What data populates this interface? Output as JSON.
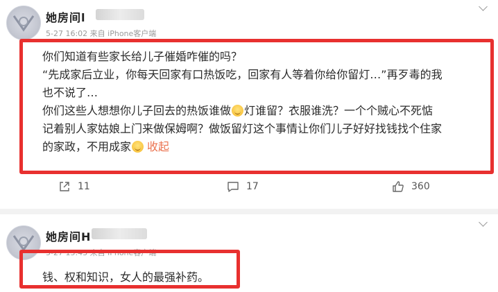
{
  "posts": [
    {
      "username": "她房间l",
      "meta": "5-27 16:02 来自 iPhone客户端",
      "lines": [
        "你们知道有些家长给儿子催婚咋催的吗？",
        "“先成家后立业，你每天回家有口热饭吃，回家有人等着你给你留灯…”再歹毒的我",
        "也不说了…",
        "你们这些人想想你儿子回去的热饭谁做",
        "灯谁留？衣服谁洗？一个个贼心不死惦",
        "记着别人家姑娘上门来做保姆啊？做饭留灯这个事情让你们儿子好好找钱找个住家",
        "的家政，不用成家"
      ],
      "collapse_label": "收起",
      "actions": {
        "repost": "11",
        "comment": "17",
        "like": "360"
      }
    },
    {
      "username": "她房间H",
      "meta": "5-27 15:43 来自 iPhone客户端",
      "lines": [
        "钱、权和知识，女人的最强补药。"
      ]
    }
  ],
  "colors": {
    "highlight_box": "#e8302f",
    "collapse_link": "#eb7350",
    "divider": "#f2f2f2"
  },
  "icons": [
    "repost-icon",
    "comment-icon",
    "like-icon",
    "chevron-down-icon",
    "smile-emoji"
  ]
}
